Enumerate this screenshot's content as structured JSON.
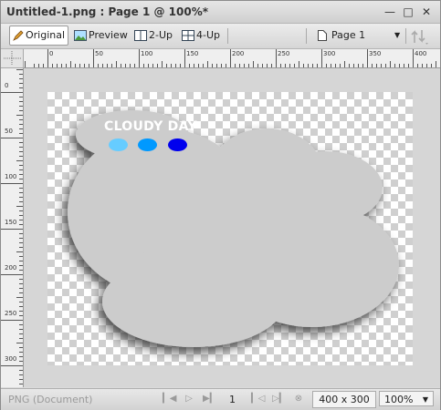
{
  "window": {
    "title": "Untitled-1.png : Page 1 @ 100%*",
    "controls": [
      "minimize-icon",
      "maximize-icon",
      "close-icon"
    ]
  },
  "toolbar": {
    "original_label": "Original",
    "preview_label": "Preview",
    "two_up_label": "2-Up",
    "four_up_label": "4-Up",
    "page_select": "Page 1"
  },
  "rulers": {
    "horizontal": [
      "0",
      "50",
      "100",
      "150",
      "200",
      "250",
      "300",
      "350",
      "400"
    ],
    "vertical": [
      "0",
      "50",
      "100",
      "150",
      "200",
      "250",
      "300"
    ]
  },
  "document": {
    "headline": "CLOUDY DAY",
    "dot_colors": [
      "#66ccff",
      "#0099ff",
      "#0000ee"
    ],
    "cloud_color": "#cccccc"
  },
  "status": {
    "doc_type": "PNG (Document)",
    "page_number": "1",
    "canvas_size": "400 x 300",
    "zoom": "100%"
  }
}
